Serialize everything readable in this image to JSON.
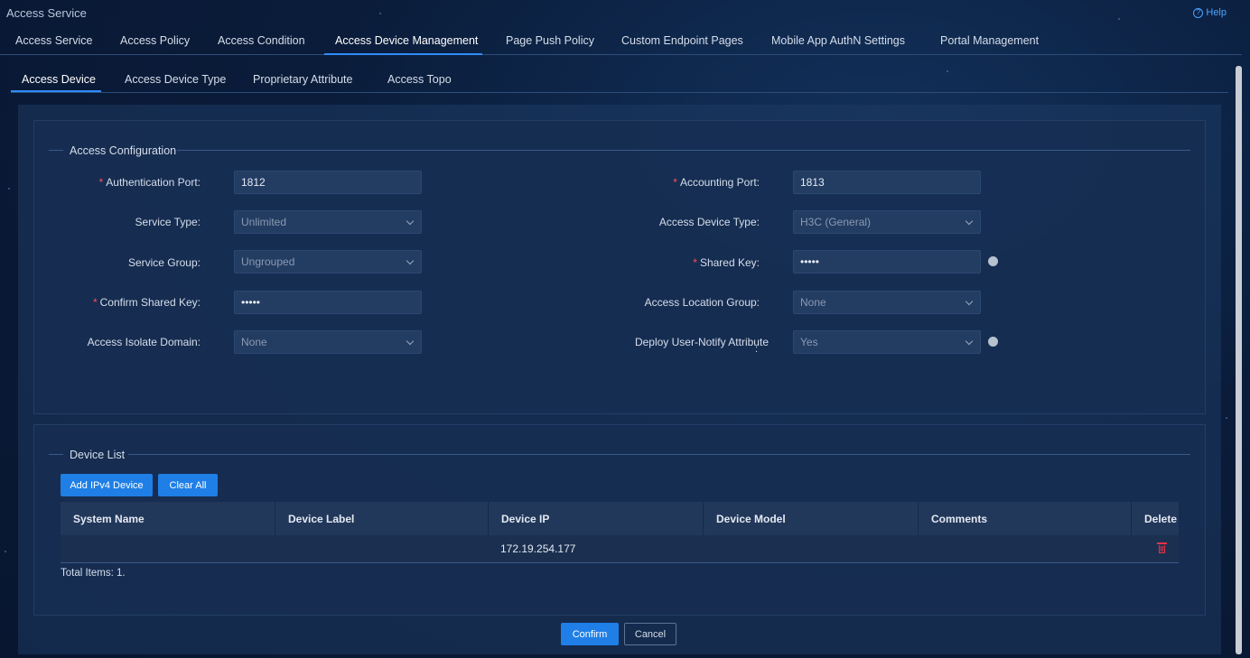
{
  "app": {
    "title": "Access Service",
    "help_label": "Help"
  },
  "main_tabs": [
    {
      "label": "Access Service"
    },
    {
      "label": "Access Policy"
    },
    {
      "label": "Access Condition"
    },
    {
      "label": "Access Device Management",
      "active": true
    },
    {
      "label": "Page Push Policy"
    },
    {
      "label": "Custom Endpoint Pages"
    },
    {
      "label": "Mobile App AuthN Settings"
    },
    {
      "label": "Portal Management"
    }
  ],
  "sub_tabs": [
    {
      "label": "Access Device",
      "active": true
    },
    {
      "label": "Access Device Type"
    },
    {
      "label": "Proprietary Attribute"
    },
    {
      "label": "Access Topo"
    }
  ],
  "config": {
    "section_title": "Access Configuration",
    "required_mark": "*",
    "auth_port": {
      "label": "Authentication Port:",
      "value": "1812"
    },
    "acct_port": {
      "label": "Accounting Port:",
      "value": "1813"
    },
    "service_type": {
      "label": "Service Type:",
      "value": "Unlimited"
    },
    "access_device_type": {
      "label": "Access Device Type:",
      "value": "H3C (General)"
    },
    "service_group": {
      "label": "Service Group:",
      "value": "Ungrouped"
    },
    "shared_key": {
      "label": "Shared Key:",
      "value": "•••••"
    },
    "confirm_shared_key": {
      "label": "Confirm Shared Key:",
      "value": "•••••"
    },
    "access_location_group": {
      "label": "Access Location Group:",
      "value": "None"
    },
    "access_isolate_domain": {
      "label": "Access Isolate Domain:",
      "value": "None"
    },
    "deploy_user_notify": {
      "label": "Deploy User-Notify Attribute",
      "colon": ":",
      "value": "Yes"
    }
  },
  "device_list": {
    "section_title": "Device List",
    "add_button": "Add IPv4 Device",
    "clear_button": "Clear All",
    "columns": [
      "System Name",
      "Device Label",
      "Device IP",
      "Device Model",
      "Comments",
      "Delete"
    ],
    "rows": [
      {
        "system_name": "",
        "device_label": "",
        "device_ip": "172.19.254.177",
        "device_model": "",
        "comments": ""
      }
    ],
    "total_text": "Total Items: 1."
  },
  "footer": {
    "confirm": "Confirm",
    "cancel": "Cancel"
  },
  "colors": {
    "accent": "#1f7fe6",
    "required": "#ff4d5a",
    "delete": "#e8344b"
  }
}
